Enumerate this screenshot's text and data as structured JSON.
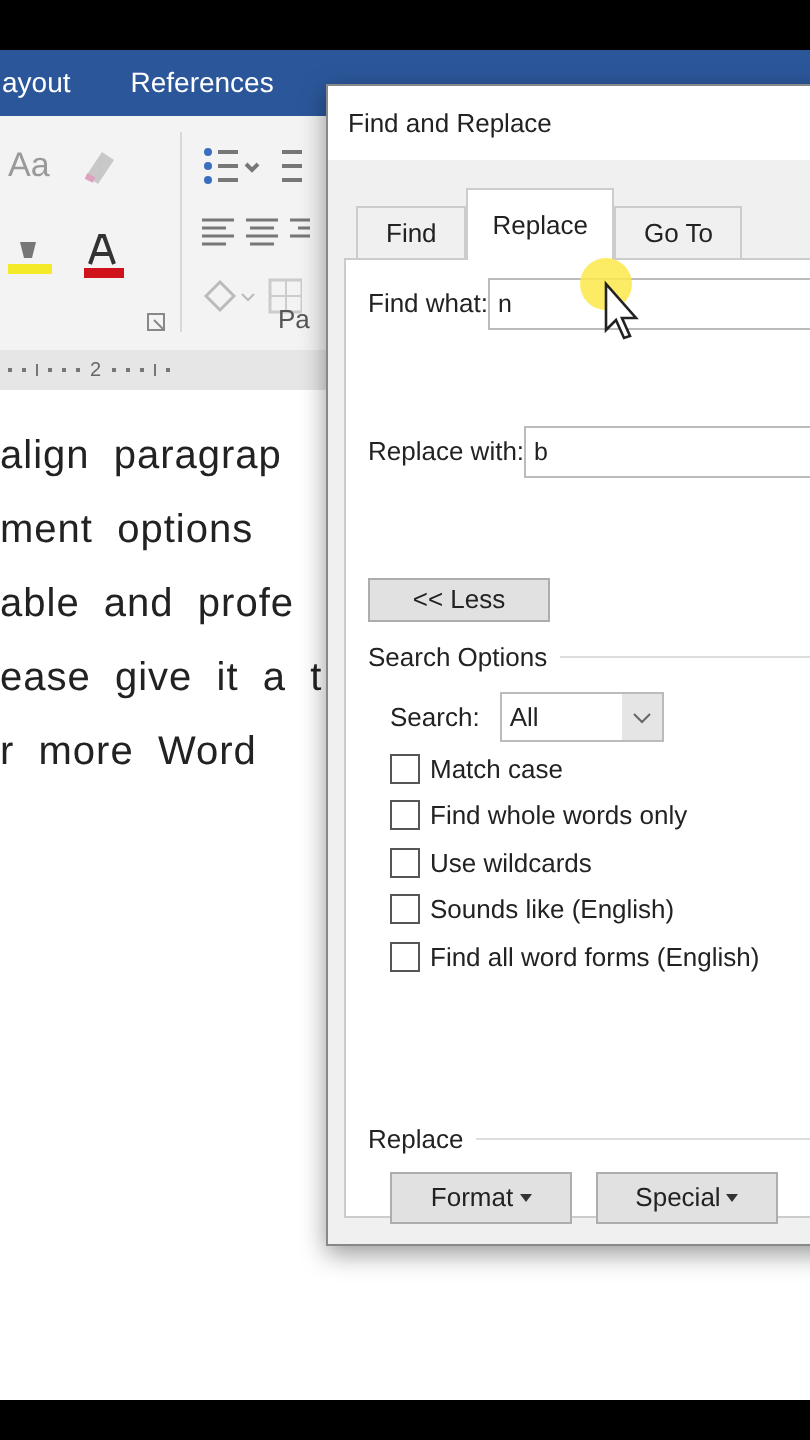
{
  "ribbon_tabs": [
    {
      "label": "ayout"
    },
    {
      "label": "References"
    }
  ],
  "ribbon": {
    "font_case": "Aa",
    "group_label": "Pa"
  },
  "ruler": {
    "mark": "2"
  },
  "document": {
    "lines": [
      "align  paragrap",
      "ment  options",
      "able  and  profe",
      "ease  give  it  a  t",
      "r  more  Word"
    ]
  },
  "dialog": {
    "title": "Find and Replace",
    "tabs": [
      {
        "label": "Find",
        "selected": false
      },
      {
        "label": "Replace",
        "selected": true
      },
      {
        "label": "Go To",
        "selected": false
      }
    ],
    "find_what": {
      "label": "Find what:",
      "value": "n"
    },
    "replace_with": {
      "label": "Replace with:",
      "value": "b"
    },
    "less_button": {
      "label": "<< Less"
    },
    "search_options": {
      "title": "Search Options",
      "search_label": "Search:",
      "search_value": "All",
      "options": [
        {
          "label": "Match case",
          "checked": false
        },
        {
          "label": "Find whole words only",
          "checked": false
        },
        {
          "label": "Use wildcards",
          "checked": false
        },
        {
          "label": "Sounds like (English)",
          "checked": false
        },
        {
          "label": "Find all word forms (English)",
          "checked": false
        }
      ]
    },
    "replace_section": {
      "title": "Replace",
      "buttons": [
        {
          "label": "Format"
        },
        {
          "label": "Special"
        }
      ]
    }
  }
}
